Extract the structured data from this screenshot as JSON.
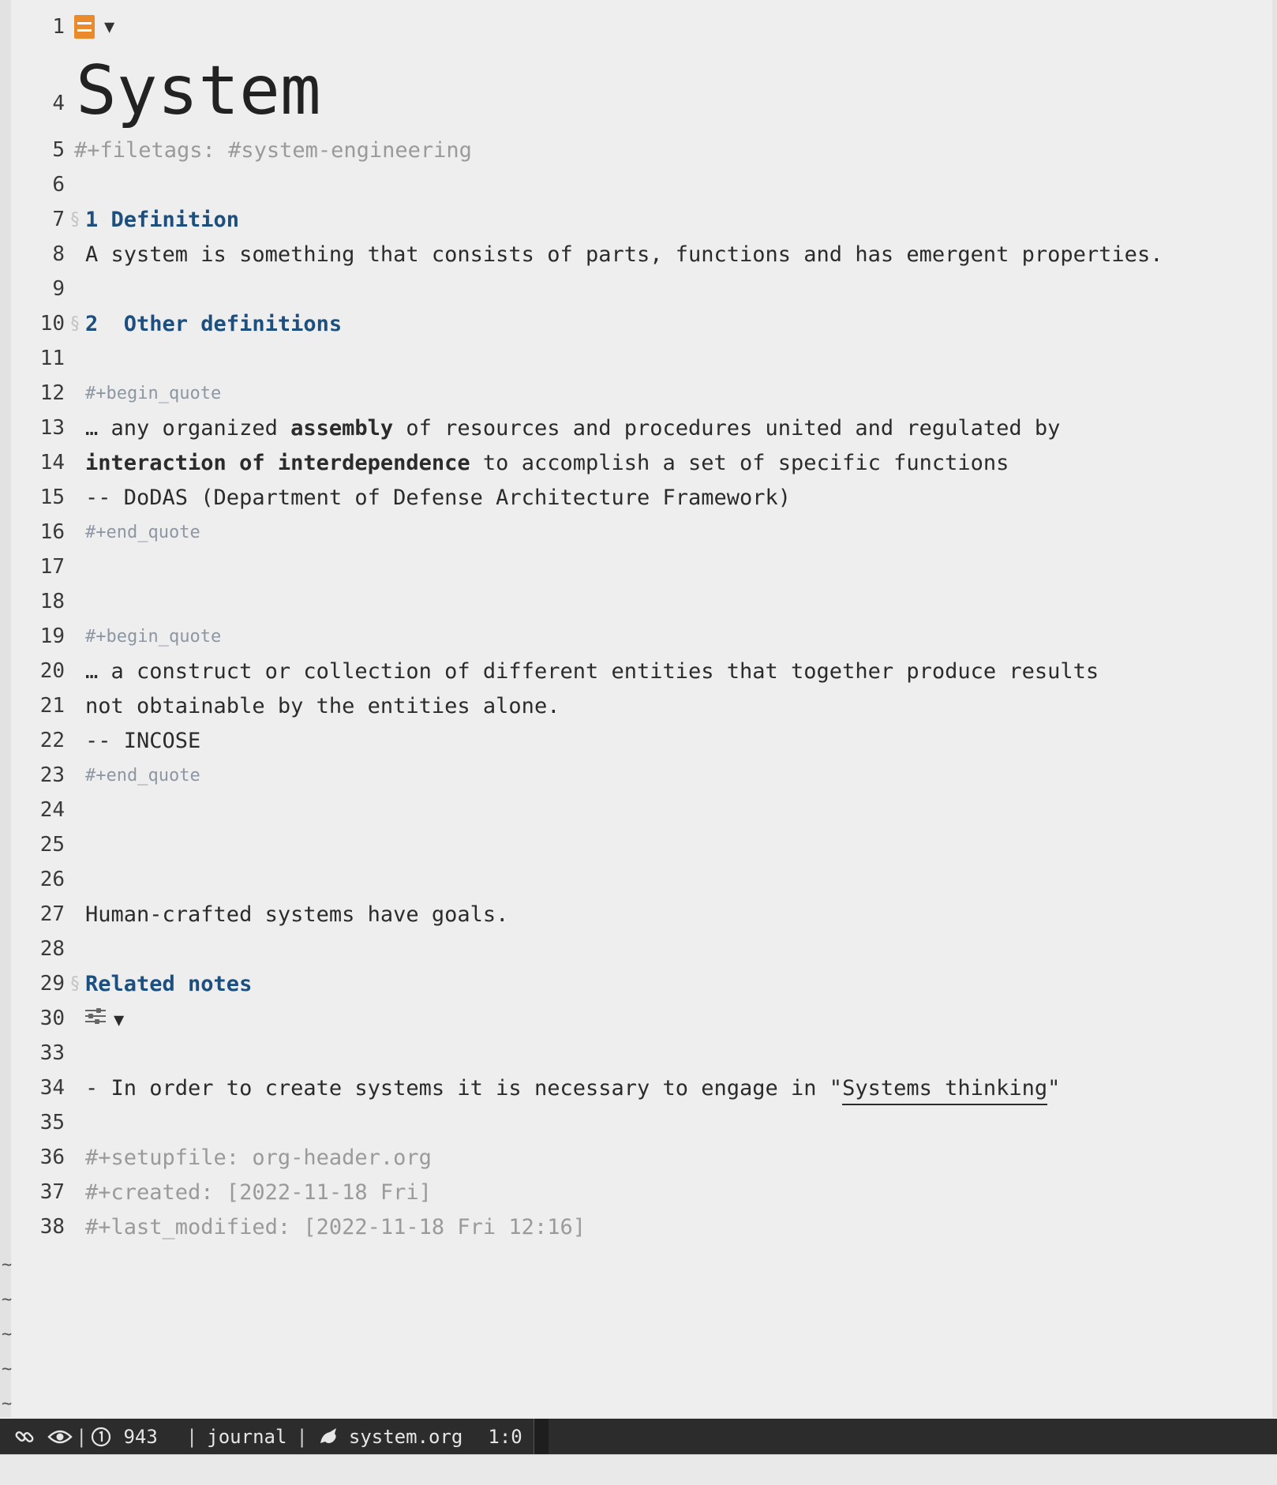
{
  "title": "System",
  "lines": [
    {
      "num": "5",
      "kind": "meta",
      "text": "#+filetags: #system-engineering"
    },
    {
      "num": "6",
      "kind": "empty",
      "text": ""
    },
    {
      "num": "7",
      "kind": "heading",
      "marker": "§",
      "text": "1 Definition"
    },
    {
      "num": "8",
      "kind": "text",
      "text": "A system is something that consists of parts, functions and has emergent properties."
    },
    {
      "num": "9",
      "kind": "empty",
      "text": ""
    },
    {
      "num": "10",
      "kind": "heading",
      "marker": "§",
      "text": "2  Other definitions"
    },
    {
      "num": "11",
      "kind": "empty",
      "text": ""
    },
    {
      "num": "12",
      "kind": "block",
      "text": "#+begin_quote"
    },
    {
      "num": "13",
      "kind": "rich",
      "parts": [
        {
          "t": "… any organized ",
          "b": false
        },
        {
          "t": "assembly",
          "b": true
        },
        {
          "t": " of resources and procedures united and regulated by",
          "b": false
        }
      ]
    },
    {
      "num": "14",
      "kind": "rich",
      "parts": [
        {
          "t": "interaction of interdependence",
          "b": true
        },
        {
          "t": " to accomplish a set of specific functions",
          "b": false
        }
      ]
    },
    {
      "num": "15",
      "kind": "text",
      "text": "-- DoDAS (Department of Defense Architecture Framework)"
    },
    {
      "num": "16",
      "kind": "block",
      "text": "#+end_quote"
    },
    {
      "num": "17",
      "kind": "empty",
      "text": ""
    },
    {
      "num": "18",
      "kind": "empty",
      "text": ""
    },
    {
      "num": "19",
      "kind": "block",
      "text": "#+begin_quote"
    },
    {
      "num": "20",
      "kind": "text",
      "text": "… a construct or collection of different entities that together produce results"
    },
    {
      "num": "21",
      "kind": "text",
      "text": "not obtainable by the entities alone."
    },
    {
      "num": "22",
      "kind": "text",
      "text": "-- INCOSE"
    },
    {
      "num": "23",
      "kind": "block",
      "text": "#+end_quote"
    },
    {
      "num": "24",
      "kind": "empty",
      "text": ""
    },
    {
      "num": "25",
      "kind": "empty",
      "text": ""
    },
    {
      "num": "26",
      "kind": "empty",
      "text": ""
    },
    {
      "num": "27",
      "kind": "text",
      "text": "Human-crafted systems have goals."
    },
    {
      "num": "28",
      "kind": "empty",
      "text": ""
    },
    {
      "num": "29",
      "kind": "heading",
      "marker": "§",
      "text": "Related notes"
    },
    {
      "num": "30",
      "kind": "drawer",
      "text": "▼"
    },
    {
      "num": "33",
      "kind": "empty",
      "text": ""
    },
    {
      "num": "34",
      "kind": "link",
      "before": "- In order to create systems it is necessary to engage in \"",
      "link": "Systems thinking",
      "after": "\""
    },
    {
      "num": "35",
      "kind": "empty",
      "text": ""
    },
    {
      "num": "36",
      "kind": "meta",
      "text": "#+setupfile: org-header.org"
    },
    {
      "num": "37",
      "kind": "meta",
      "text": "#+created: [2022-11-18 Fri]"
    },
    {
      "num": "38",
      "kind": "meta",
      "text": "#+last_modified: [2022-11-18 Fri 12:16]"
    }
  ],
  "line1": {
    "num": "1",
    "triangle": "▼"
  },
  "line4": {
    "num": "4"
  },
  "tilde": "~",
  "tilde_count": 5,
  "modeline": {
    "count": "943",
    "workspace": "journal",
    "filename": "system.org",
    "position": "1:0",
    "separator": "|"
  },
  "icons": {
    "org_file": "org-file-icon",
    "sliders": "sliders-icon",
    "link": "link-icon",
    "eye": "eye-icon",
    "info": "info-circle-icon",
    "mode": "org-mode-icon"
  },
  "colors": {
    "heading": "#1d4f7e",
    "meta": "#9a9a9a",
    "accent": "#e98a2c",
    "modeline_bg": "#2c2c2c"
  }
}
